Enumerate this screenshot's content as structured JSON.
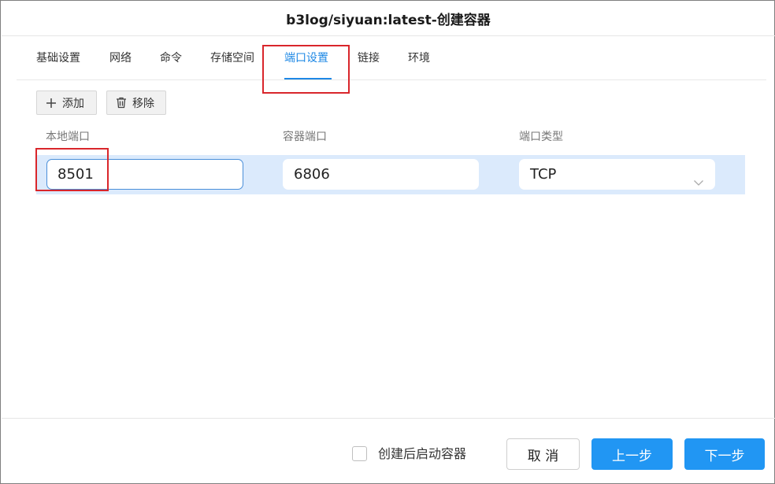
{
  "window": {
    "title": "b3log/siyuan:latest-创建容器"
  },
  "tabs": [
    {
      "label": "基础设置"
    },
    {
      "label": "网络"
    },
    {
      "label": "命令"
    },
    {
      "label": "存储空间"
    },
    {
      "label": "端口设置",
      "active": true
    },
    {
      "label": "链接"
    },
    {
      "label": "环境"
    }
  ],
  "toolbar": {
    "add_label": "添加",
    "remove_label": "移除",
    "add_icon": "plus-icon",
    "remove_icon": "trash-icon"
  },
  "ports": {
    "columns": [
      "本地端口",
      "容器端口",
      "端口类型"
    ],
    "rows": [
      {
        "local_port": "8501",
        "container_port": "6806",
        "type": "TCP"
      }
    ]
  },
  "footer": {
    "autostart_label": "创建后启动容器",
    "autostart_checked": false,
    "cancel_label": "取 消",
    "prev_label": "上一步",
    "next_label": "下一步"
  },
  "colors": {
    "accent": "#2196f3",
    "row_highlight": "#dbeafc",
    "annotation": "#d9262b"
  }
}
